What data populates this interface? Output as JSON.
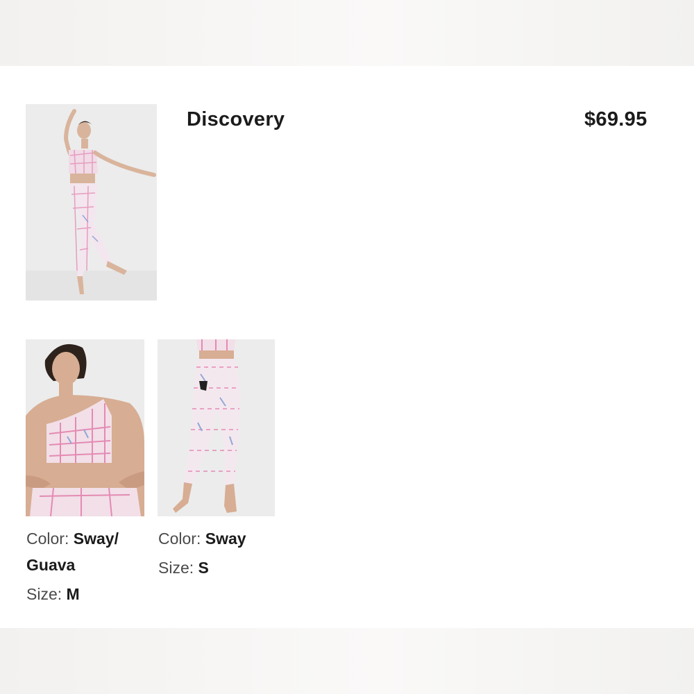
{
  "product": {
    "title": "Discovery",
    "price": "$69.95"
  },
  "items": [
    {
      "color_label": "Color:",
      "color_value_line1": "Sway/",
      "color_value_line2": "Guava",
      "size_label": "Size:",
      "size_value": "M"
    },
    {
      "color_label": "Color:",
      "color_value": "Sway",
      "size_label": "Size:",
      "size_value": "S"
    }
  ]
}
